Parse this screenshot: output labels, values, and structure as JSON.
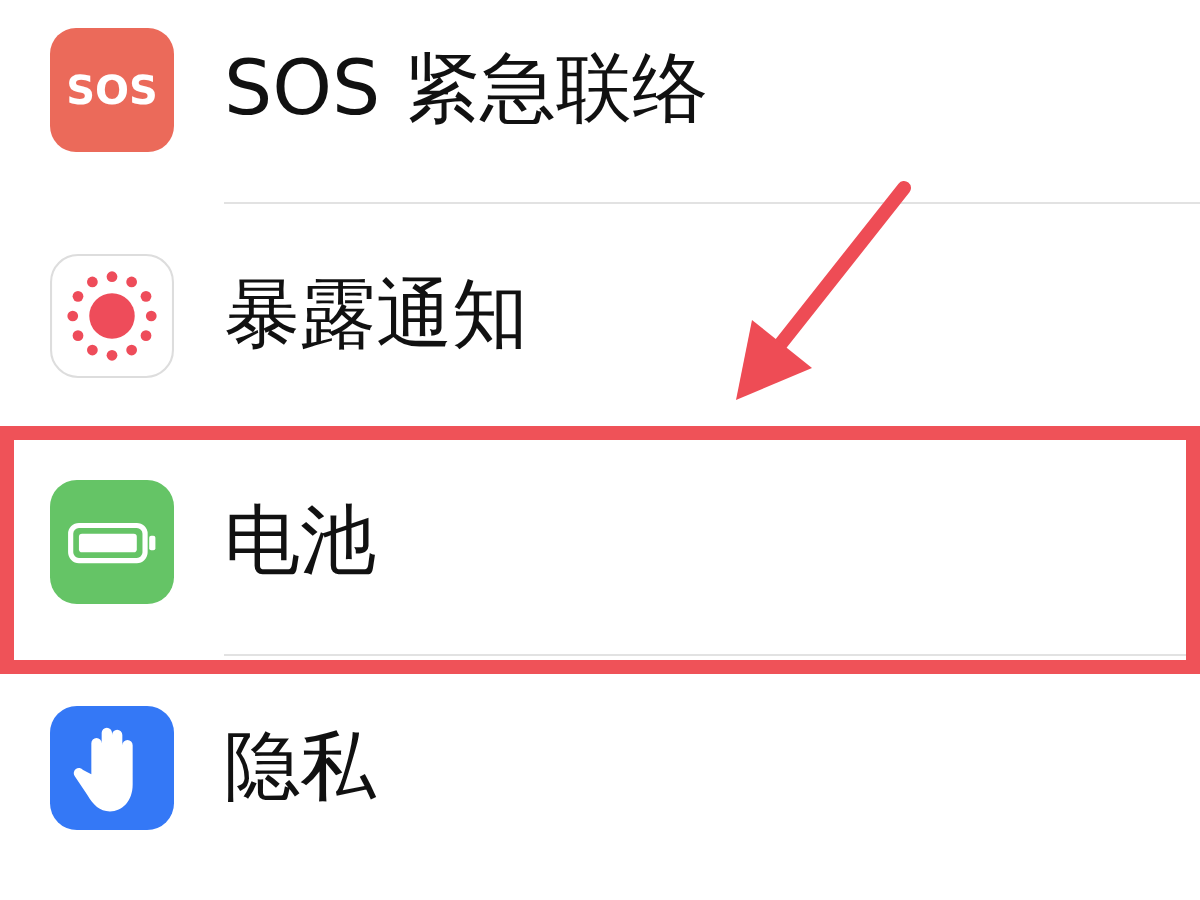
{
  "settings": [
    {
      "kind": "sos",
      "icon_text": "SOS",
      "label": "SOS 紧急联络",
      "highlighted": false
    },
    {
      "kind": "exposure",
      "label": "暴露通知",
      "highlighted": false
    },
    {
      "kind": "battery",
      "label": "电池",
      "highlighted": true
    },
    {
      "kind": "privacy",
      "label": "隐私",
      "highlighted": false
    }
  ]
}
